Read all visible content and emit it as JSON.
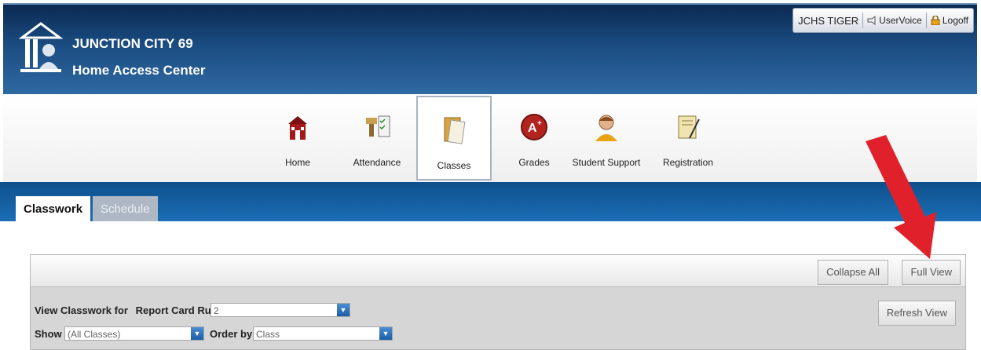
{
  "header": {
    "org_title": "JUNCTION CITY 69",
    "org_subtitle": "Home Access Center",
    "user_name": "JCHS TIGER",
    "uservoice_label": "UserVoice",
    "logoff_label": "Logoff"
  },
  "nav": {
    "items": [
      {
        "label": "Home",
        "icon": "home-icon"
      },
      {
        "label": "Attendance",
        "icon": "attendance-icon"
      },
      {
        "label": "Classes",
        "icon": "classes-icon",
        "active": true
      },
      {
        "label": "Grades",
        "icon": "grades-icon"
      },
      {
        "label": "Student Support",
        "icon": "student-support-icon"
      },
      {
        "label": "Registration",
        "icon": "registration-icon"
      }
    ]
  },
  "tabs": [
    {
      "label": "Classwork",
      "active": true
    },
    {
      "label": "Schedule",
      "active": false
    }
  ],
  "toolbar": {
    "collapse_all_label": "Collapse All",
    "full_view_label": "Full View",
    "refresh_view_label": "Refresh View"
  },
  "filters": {
    "view_label": "View Classwork for",
    "report_card_label": "Report Card Run",
    "report_card_value": "2",
    "show_label": "Show",
    "show_value": "(All Classes)",
    "order_label": "Order by",
    "order_value": "Class"
  },
  "colors": {
    "header_blue": "#1b4d82",
    "tab_band_blue": "#1c6eb5",
    "annotation_arrow": "#e0212b"
  }
}
